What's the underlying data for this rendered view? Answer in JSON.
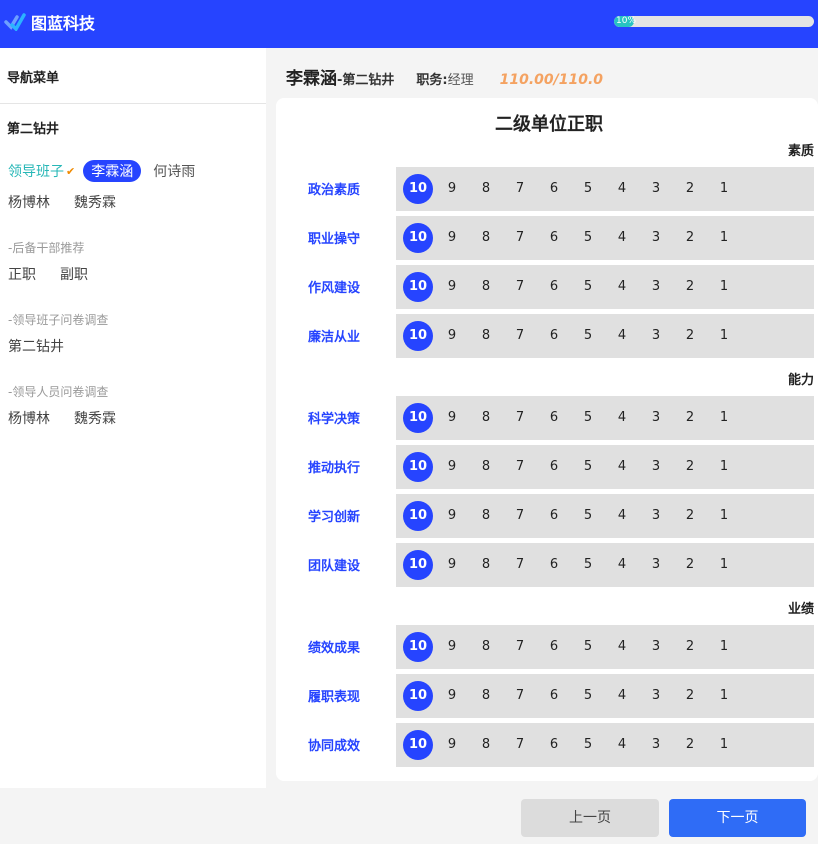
{
  "app": {
    "logo_text": "图蓝科技"
  },
  "progress": {
    "value_percent": 10,
    "label": "10%"
  },
  "sidebar": {
    "title": "导航菜单",
    "group": "第二钻井",
    "leader_tag": "领导班子",
    "people_top": [
      "李霖涵",
      "何诗雨"
    ],
    "people_second": [
      "杨博林",
      "魏秀霖"
    ],
    "sections": [
      {
        "title": "-后备干部推荐",
        "items": [
          "正职",
          "副职"
        ]
      },
      {
        "title": "-领导班子问卷调查",
        "items": [
          "第二钻井"
        ]
      },
      {
        "title": "-领导人员问卷调查",
        "items": [
          "杨博林",
          "魏秀霖"
        ]
      }
    ]
  },
  "header": {
    "name": "李霖涵",
    "dept": "-第二钻井",
    "duty_label": "职务:",
    "duty": "经理",
    "score": "110.00/110.0"
  },
  "card": {
    "title": "二级单位正职",
    "sections": [
      "素质",
      "能力",
      "业绩"
    ],
    "options": [
      "10",
      "9",
      "8",
      "7",
      "6",
      "5",
      "4",
      "3",
      "2",
      "1"
    ],
    "rows": [
      {
        "label": "政治素质",
        "selected": "10"
      },
      {
        "label": "职业操守",
        "selected": "10"
      },
      {
        "label": "作风建设",
        "selected": "10"
      },
      {
        "label": "廉洁从业",
        "selected": "10"
      },
      {
        "label": "科学决策",
        "selected": "10"
      },
      {
        "label": "推动执行",
        "selected": "10"
      },
      {
        "label": "学习创新",
        "selected": "10"
      },
      {
        "label": "团队建设",
        "selected": "10"
      },
      {
        "label": "绩效成果",
        "selected": "10"
      },
      {
        "label": "履职表现",
        "selected": "10"
      },
      {
        "label": "协同成效",
        "selected": "10"
      }
    ]
  },
  "footer": {
    "prev": "上一页",
    "next": "下一页"
  }
}
